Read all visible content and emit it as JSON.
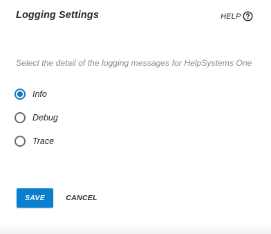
{
  "header": {
    "title": "Logging Settings",
    "help_label": "HELP",
    "help_icon": "help-circle-icon"
  },
  "logging": {
    "description": "Select the detail of the logging messages for HelpSystems One",
    "options": [
      {
        "label": "Info",
        "checked": true
      },
      {
        "label": "Debug",
        "checked": false
      },
      {
        "label": "Trace",
        "checked": false
      }
    ]
  },
  "actions": {
    "save_label": "SAVE",
    "cancel_label": "CANCEL"
  },
  "colors": {
    "accent": "#0a7fd0",
    "text": "#2b2b2b",
    "muted_text": "#8c8c8c"
  }
}
